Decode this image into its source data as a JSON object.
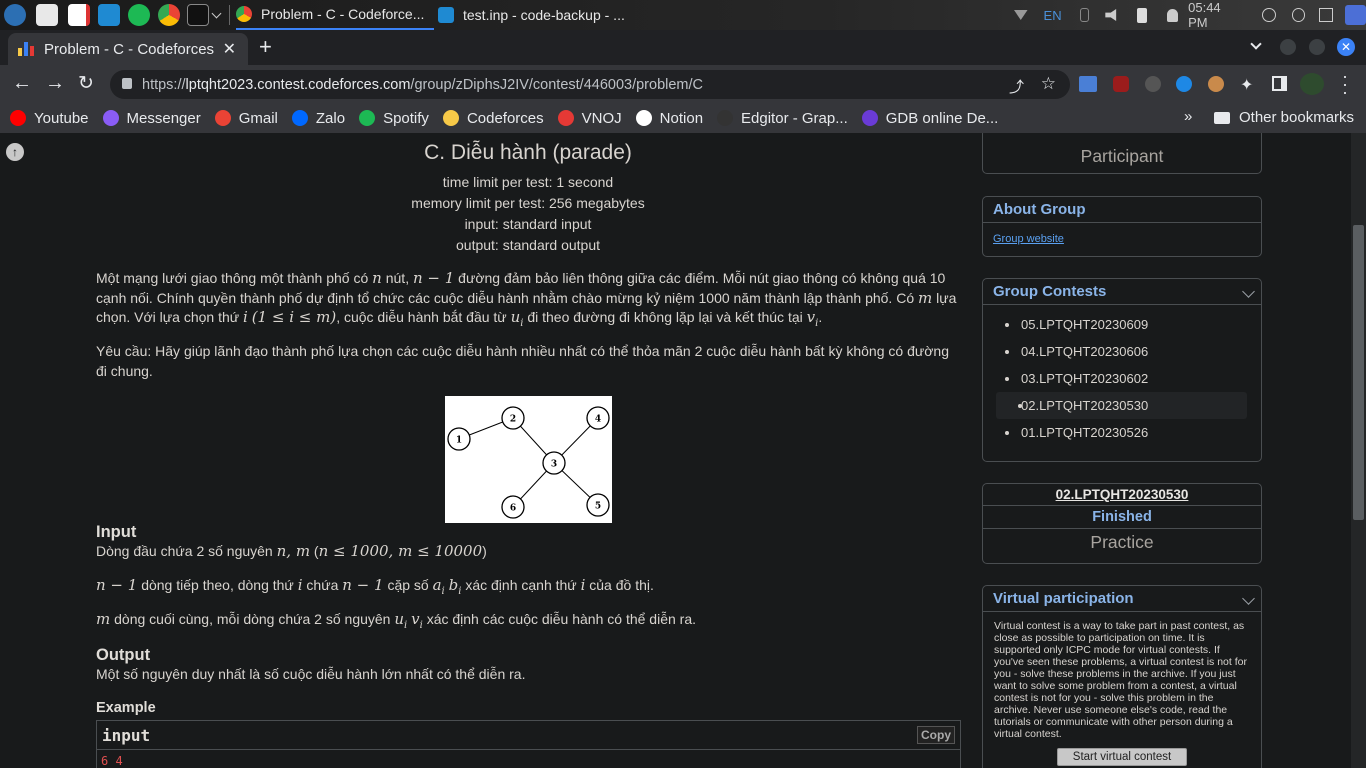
{
  "taskbar": {
    "windows": [
      {
        "title": "Problem - C - Codeforce..."
      },
      {
        "title": "test.inp - code-backup - ..."
      }
    ],
    "tray": {
      "lang": "EN",
      "clock": "05:44 PM"
    }
  },
  "browser": {
    "tab_title": "Problem - C - Codeforces",
    "url_host": "lptqht2023.contest.codeforces.com",
    "url_prefix": "https://",
    "url_path": "/group/zDiphsJ2IV/contest/446003/problem/C",
    "bookmarks": [
      {
        "label": "Youtube",
        "color": "#ff0000"
      },
      {
        "label": "Messenger",
        "color": "#8a5cf6"
      },
      {
        "label": "Gmail",
        "color": "#ea4335"
      },
      {
        "label": "Zalo",
        "color": "#0068ff"
      },
      {
        "label": "Spotify",
        "color": "#1db954"
      },
      {
        "label": "Codeforces",
        "color": "#f7c948"
      },
      {
        "label": "VNOJ",
        "color": "#e53935"
      },
      {
        "label": "Notion",
        "color": "#ffffff"
      },
      {
        "label": "Edgitor - Grap...",
        "color": "#333333"
      },
      {
        "label": "GDB online De...",
        "color": "#6a3bd6"
      }
    ],
    "other_bookmarks": "Other bookmarks",
    "more": "»"
  },
  "problem": {
    "title": "C. Diễu hành (parade)",
    "time_limit": "time limit per test: 1 second",
    "memory_limit": "memory limit per test: 256 megabytes",
    "input_file": "input: standard input",
    "output_file": "output: standard output",
    "statement_1a": "Một mạng lưới giao thông một thành phố có ",
    "statement_1b": " nút, ",
    "statement_1c": " đường đảm bảo liên thông giữa các điểm. Mỗi nút giao thông có không quá 10 cạnh nối. Chính quyền thành phố dự định tổ chức các cuộc diễu hành nhằm chào mừng kỷ niệm 1000 năm thành lập thành phố. Có ",
    "statement_1d": " lựa chọn. Với lựa chọn thứ ",
    "statement_1e": ", cuộc diễu hành bắt đầu từ ",
    "statement_1f": " đi theo đường đi không lặp lại và kết thúc tại ",
    "statement_1g": ".",
    "m_n": "n",
    "m_n1": "n − 1",
    "m_m": "m",
    "m_i": "i",
    "m_range": "(1 ≤ i ≤ m)",
    "m_u": "u",
    "m_v": "v",
    "m_sub_i": "i",
    "statement_2": "Yêu cầu: Hãy giúp lãnh đạo thành phố lựa chọn các cuộc diễu hành nhiều nhất có thể thỏa mãn 2 cuộc diễu hành bất kỳ không có đường đi chung.",
    "graph_nodes": [
      "1",
      "2",
      "3",
      "4",
      "5",
      "6"
    ],
    "input_header": "Input",
    "input_1a": "Dòng đầu chứa 2 số nguyên ",
    "input_1m": "n, m",
    "input_1b": " (",
    "input_1c": "n ≤ 1000, m ≤ 10000",
    "input_1d": ")",
    "input_2m": "n − 1",
    "input_2a": " dòng tiếp theo, dòng thứ ",
    "input_2i": "i",
    "input_2b": " chứa ",
    "input_2n": "n − 1",
    "input_2c": " cặp số ",
    "input_2ab": "a",
    "input_2bb": "b",
    "input_2d": " xác định cạnh thứ ",
    "input_2e": " của đồ thị.",
    "input_3m": "m",
    "input_3a": " dòng cuối cùng, mỗi dòng chứa 2 số nguyên ",
    "input_3b": " xác định các cuộc diễu hành có thể diễn ra.",
    "output_header": "Output",
    "output_text": "Một số nguyên duy nhất là số cuộc diễu hành lớn nhất có thể diễn ra.",
    "example_header": "Example",
    "example_input_label": "input",
    "copy_label": "Copy",
    "example_first_line": "6 4"
  },
  "sidebar": {
    "participant": "Participant",
    "about_group": "About Group",
    "group_website": "Group website",
    "group_contests": "Group Contests",
    "contests": [
      "05.LPTQHT20230609",
      "04.LPTQHT20230606",
      "03.LPTQHT20230602",
      "02.LPTQHT20230530",
      "01.LPTQHT20230526"
    ],
    "current_contest": "02.LPTQHT20230530",
    "status": "Finished",
    "mode": "Practice",
    "virtual_header": "Virtual participation",
    "virtual_text": "Virtual contest is a way to take part in past contest, as close as possible to participation on time. It is supported only ICPC mode for virtual contests. If you've seen these problems, a virtual contest is not for you - solve these problems in the archive. If you just want to solve some problem from a contest, a virtual contest is not for you - solve this problem in the archive. Never use someone else's code, read the tutorials or communicate with other person during a virtual contest.",
    "start_virtual": "Start virtual contest"
  }
}
